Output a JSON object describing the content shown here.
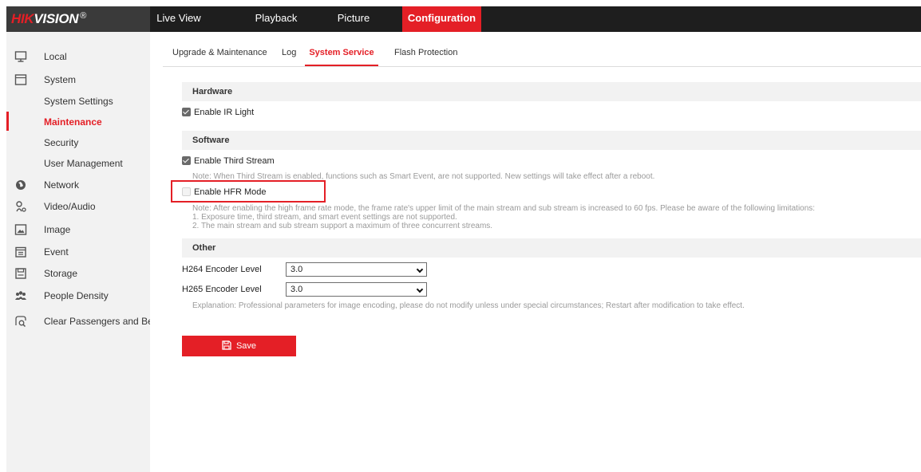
{
  "brand": {
    "logo_red": "HIK",
    "logo_white": "VISION",
    "reg_mark": "®"
  },
  "top_nav": [
    "Live View",
    "Playback",
    "Picture",
    "Configuration"
  ],
  "sidebar": {
    "local": "Local",
    "system": "System",
    "system_settings": "System Settings",
    "maintenance": "Maintenance",
    "security": "Security",
    "user_management": "User Management",
    "network": "Network",
    "video_audio": "Video/Audio",
    "image": "Image",
    "event": "Event",
    "storage": "Storage",
    "people_density": "People Density",
    "clear_passengers": "Clear Passengers and Bel..."
  },
  "sub_tabs": [
    "Upgrade & Maintenance",
    "Log",
    "System Service",
    "Flash Protection"
  ],
  "hardware": {
    "title": "Hardware",
    "enable_ir_light": "Enable IR Light"
  },
  "software": {
    "title": "Software",
    "enable_third_stream": "Enable Third Stream",
    "third_stream_note": "Note: When Third Stream is enabled, functions such as Smart Event, are not supported. New settings will take effect after a reboot.",
    "enable_hfr_mode": "Enable HFR Mode",
    "hfr_note_1": "Note: After enabling the high frame rate mode, the frame rate's upper limit of the main stream and sub stream is increased to 60 fps. Please be aware of the following limitations:",
    "hfr_note_2": "1. Exposure time, third stream, and smart event settings are not supported.",
    "hfr_note_3": "2. The main stream and sub stream support a maximum of three concurrent streams."
  },
  "other": {
    "title": "Other",
    "h264_label": "H264 Encoder Level",
    "h264_value": "3.0",
    "h265_label": "H265 Encoder Level",
    "h265_value": "3.0",
    "explanation": "Explanation: Professional parameters for image encoding, please do not modify unless under special circumstances; Restart after modification to take effect."
  },
  "save_label": "Save",
  "colors": {
    "accent": "#e41f26",
    "topbar": "#1e1e1e",
    "sidebar": "#f2f2f2"
  }
}
